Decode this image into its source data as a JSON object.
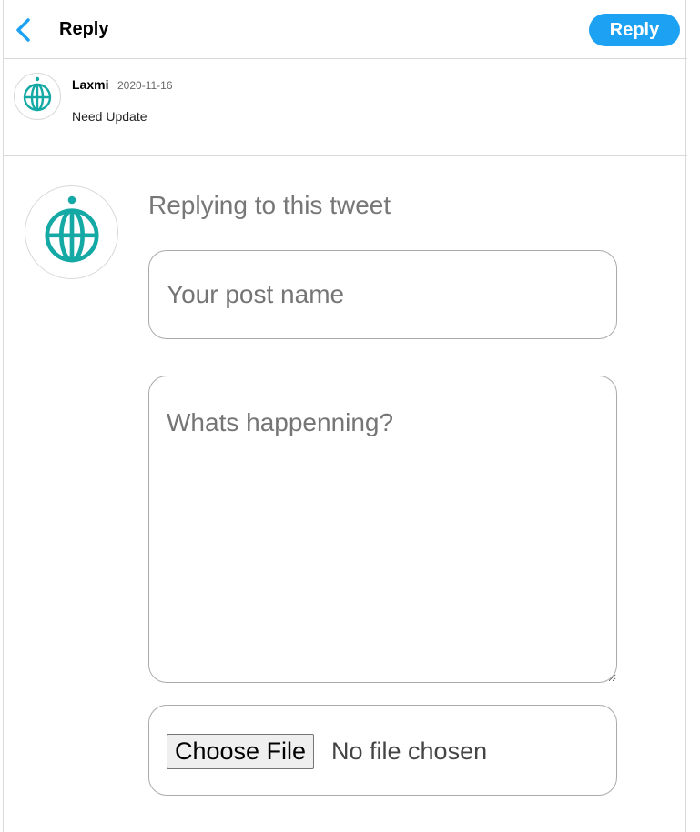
{
  "header": {
    "back_icon": "chevron-left-icon",
    "title": "Reply",
    "reply_button": "Reply",
    "accent": "#1da1f2"
  },
  "tweet": {
    "avatar_icon": "globe-icon",
    "author": "Laxmi",
    "date": "2020-11-16",
    "text": "Need Update"
  },
  "composer": {
    "avatar_icon": "globe-icon",
    "replying_label": "Replying to this tweet",
    "post_name_placeholder": "Your post name",
    "body_placeholder": "Whats happenning?",
    "choose_file_label": "Choose File",
    "file_status": "No file chosen",
    "globe_color": "#14a9a4"
  }
}
